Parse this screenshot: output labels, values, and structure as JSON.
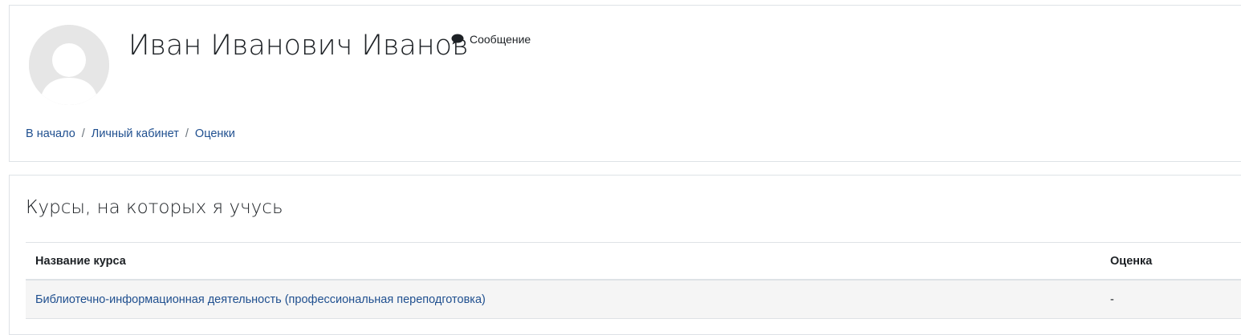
{
  "header": {
    "user_name": "Иван Иванович Иванов",
    "message_label": "Сообщение",
    "avatar_icon": "default-user-avatar",
    "message_icon": "speech-bubble-icon"
  },
  "breadcrumb": [
    {
      "label": "В начало"
    },
    {
      "label": "Личный кабинет"
    },
    {
      "label": "Оценки"
    }
  ],
  "courses": {
    "title": "Курсы, на которых я учусь",
    "columns": {
      "course_name": "Название курса",
      "grade": "Оценка"
    },
    "rows": [
      {
        "course_name": "Библиотечно-информационная деятельность (профессиональная переподготовка)",
        "grade": "-"
      }
    ]
  },
  "colors": {
    "link": "#1f4f8f",
    "text": "#1d2125",
    "border": "#dee2e6",
    "row_background": "#f5f5f5",
    "avatar_background": "#e6e6e6"
  }
}
